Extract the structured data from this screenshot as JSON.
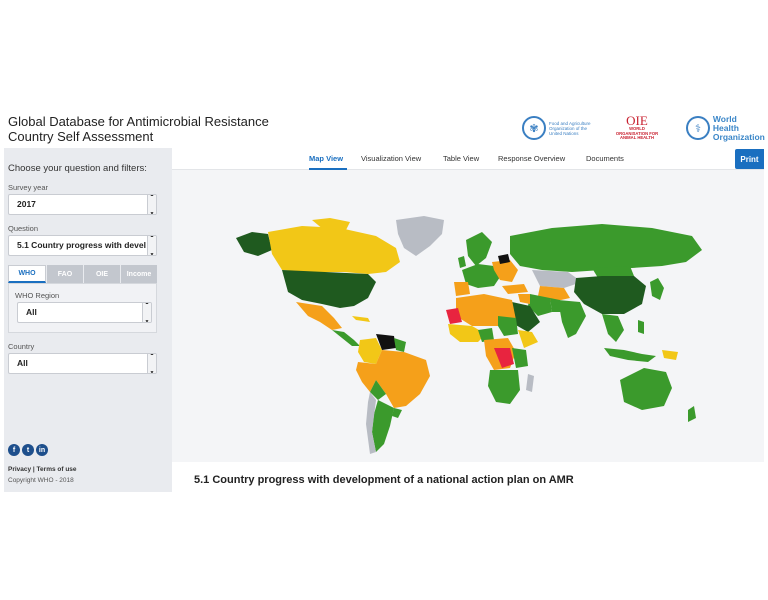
{
  "header": {
    "title_line1": "Global Database for Antimicrobial Resistance",
    "title_line2": "Country Self Assessment",
    "logos": {
      "fao_text": "Food and Agriculture Organization of the United Nations",
      "oie_mark": "OIE",
      "oie_text": "WORLD ORGANISATION FOR ANIMAL HEALTH",
      "who_text_line1": "World Health",
      "who_text_line2": "Organization"
    }
  },
  "sidebar": {
    "heading": "Choose your question and filters:",
    "survey_year_label": "Survey year",
    "survey_year_value": "2017",
    "question_label": "Question",
    "question_value": "5.1 Country progress with devel",
    "tabs": [
      "WHO",
      "FAO",
      "OIE",
      "Income"
    ],
    "who_region_label": "WHO Region",
    "who_region_value": "All",
    "country_label": "Country",
    "country_value": "All",
    "social": [
      "f",
      "t",
      "in"
    ],
    "footer_links": "Privacy | Terms of use",
    "copyright": "Copyright WHO - 2018"
  },
  "nav": {
    "items": [
      "Map View",
      "Visualization View",
      "Table View",
      "Response Overview",
      "Documents"
    ],
    "print_label": "Print"
  },
  "main": {
    "question_title": "5.1 Country progress with development of a national action plan on AMR"
  },
  "colors": {
    "accent": "#1a6fc0",
    "map_dark_green": "#1f5a1f",
    "map_green": "#3b9a2c",
    "map_orange": "#f5a01a",
    "map_yellow": "#f2c717",
    "map_red": "#e8243f",
    "map_grey": "#b8bcc4",
    "map_black": "#111111"
  }
}
